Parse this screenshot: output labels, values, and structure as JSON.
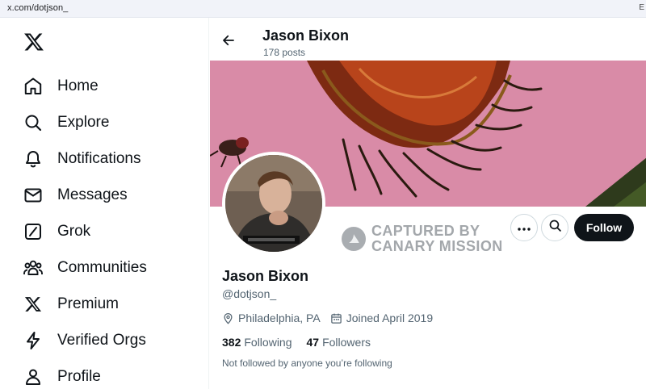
{
  "browser": {
    "url": "x.com/dotjson_",
    "edge_glyph": "E"
  },
  "sidebar": {
    "logo": "x-logo-icon",
    "items": [
      {
        "label": "Home",
        "icon": "home-icon"
      },
      {
        "label": "Explore",
        "icon": "search-icon"
      },
      {
        "label": "Notifications",
        "icon": "bell-icon"
      },
      {
        "label": "Messages",
        "icon": "mail-icon"
      },
      {
        "label": "Grok",
        "icon": "grok-icon"
      },
      {
        "label": "Communities",
        "icon": "communities-icon"
      },
      {
        "label": "Premium",
        "icon": "x-premium-icon"
      },
      {
        "label": "Verified Orgs",
        "icon": "lightning-icon"
      },
      {
        "label": "Profile",
        "icon": "person-icon"
      }
    ]
  },
  "header": {
    "name": "Jason Bixon",
    "posts": "178 posts"
  },
  "watermark": {
    "line1": "CAPTURED BY",
    "line2": "CANARY MISSION"
  },
  "actions": {
    "follow": "Follow"
  },
  "profile": {
    "name": "Jason Bixon",
    "handle": "@dotjson_",
    "location": "Philadelphia, PA",
    "joined": "Joined April 2019",
    "following_count": "382",
    "following_label": "Following",
    "followers_count": "47",
    "followers_label": "Followers",
    "not_followed": "Not followed by anyone you’re following"
  },
  "colors": {
    "banner": "#d98ba7",
    "follow_button": "#0f1419",
    "secondary_text": "#536471"
  }
}
